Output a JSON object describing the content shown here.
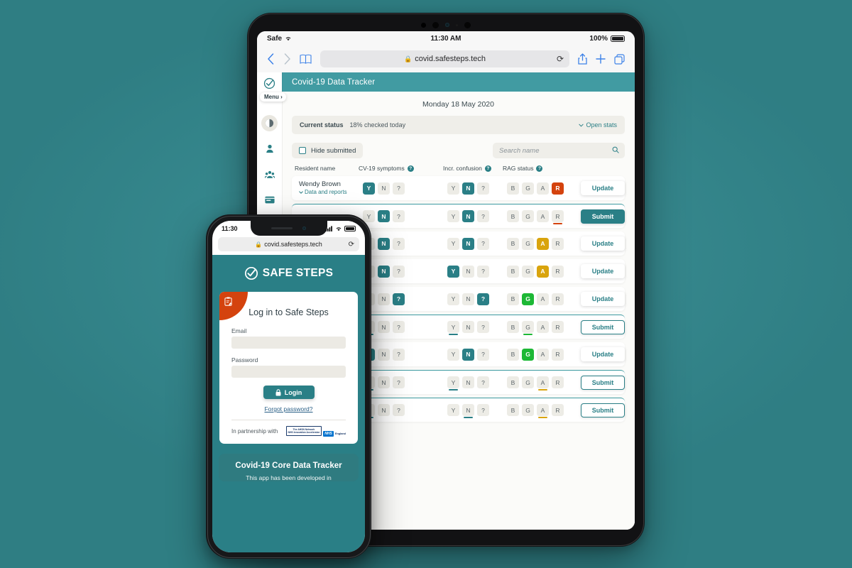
{
  "tablet": {
    "ios_status": {
      "carrier": "Safe",
      "time": "11:30 AM",
      "battery": "100%"
    },
    "browser": {
      "url": "covid.safesteps.tech",
      "lock_icon": "lock-icon",
      "reload_icon": "reload-icon"
    },
    "sidebar": {
      "logo_icon": "safe-steps-logo-icon",
      "menu_label": "Menu",
      "items": [
        {
          "icon": "contrast-avatar-icon"
        },
        {
          "icon": "person-icon"
        },
        {
          "icon": "group-icon"
        },
        {
          "icon": "card-icon"
        },
        {
          "icon": "user-circle-icon"
        }
      ]
    },
    "app": {
      "header_title": "Covid-19 Data Tracker",
      "date": "Monday 18 May 2020",
      "status": {
        "label": "Current status",
        "percent_text": "18% checked today",
        "open_stats": "Open stats"
      },
      "filters": {
        "hide_submitted": "Hide submitted",
        "search_placeholder": "Search name",
        "search_value": ""
      },
      "columns": {
        "name": "Resident name",
        "symptoms": "CV-19 symptoms",
        "confusion": "Incr. confusion",
        "rag": "RAG status",
        "help": "?"
      },
      "options": {
        "yn": [
          "Y",
          "N",
          "?"
        ],
        "rag": [
          "B",
          "G",
          "A",
          "R"
        ]
      },
      "buttons": {
        "update": "Update",
        "submit": "Submit"
      },
      "rows": [
        {
          "name": "Wendy Brown",
          "sub": "Data and reports",
          "symptoms_sel": 0,
          "confusion_sel": 1,
          "rag_sel": 3,
          "rag_color": "r",
          "action": "update",
          "pending": false
        },
        {
          "name": "",
          "sub": "",
          "symptoms_sel": 1,
          "confusion_sel": 1,
          "rag_mark": 3,
          "rag_color": "r",
          "action": "submit-fill",
          "pending": true
        },
        {
          "name": "",
          "sub": "",
          "symptoms_sel": 1,
          "confusion_sel": 1,
          "rag_sel": 2,
          "rag_color": "a",
          "action": "update",
          "pending": false
        },
        {
          "name": "",
          "sub": "",
          "symptoms_sel": 1,
          "confusion_sel": 0,
          "rag_sel": 2,
          "rag_color": "a",
          "action": "update",
          "pending": false
        },
        {
          "name": "",
          "sub": "",
          "symptoms_sel": 2,
          "confusion_sel": 2,
          "rag_sel": 1,
          "rag_color": "g",
          "action": "update",
          "pending": false
        },
        {
          "name": "",
          "sub": "",
          "symptoms_mark": 0,
          "confusion_mark": 0,
          "rag_mark": 1,
          "rag_color": "g",
          "action": "submit-out",
          "pending": true
        },
        {
          "name": "",
          "sub": "",
          "symptoms_sel": 0,
          "confusion_sel": 1,
          "rag_sel": 1,
          "rag_color": "g",
          "action": "update",
          "pending": false
        },
        {
          "name": "",
          "sub": "",
          "symptoms_mark": 0,
          "confusion_mark": 0,
          "rag_mark": 2,
          "rag_color": "a",
          "action": "submit-out",
          "pending": true
        },
        {
          "name": "",
          "sub": "",
          "symptoms_mark": 0,
          "confusion_mark": 1,
          "rag_mark": 2,
          "rag_color": "a",
          "action": "submit-out",
          "pending": true
        }
      ]
    }
  },
  "phone": {
    "status": {
      "time": "11:30"
    },
    "browser": {
      "url": "covid.safesteps.tech"
    },
    "brand": "SAFE STEPS",
    "login": {
      "title": "Log in to Safe Steps",
      "email_label": "Email",
      "email_value": "",
      "password_label": "Password",
      "password_value": "",
      "login_button": "Login",
      "forgot": "Forgot password?",
      "partnership_label": "In partnership with",
      "ahsn_line1": "The AHSN Network",
      "ahsn_line2": "NHS Innovation Accelerator",
      "nhs_logo": "NHS",
      "nhs_sub": "England"
    },
    "bottom_card": {
      "title": "Covid-19 Core Data Tracker",
      "desc": "This app has been developed in"
    }
  },
  "colors": {
    "background": "#348c92",
    "brand_teal": "#2a7f86",
    "header_teal": "#419ba2",
    "red": "#d4430e",
    "amber": "#d9a40d",
    "green": "#1db835"
  }
}
